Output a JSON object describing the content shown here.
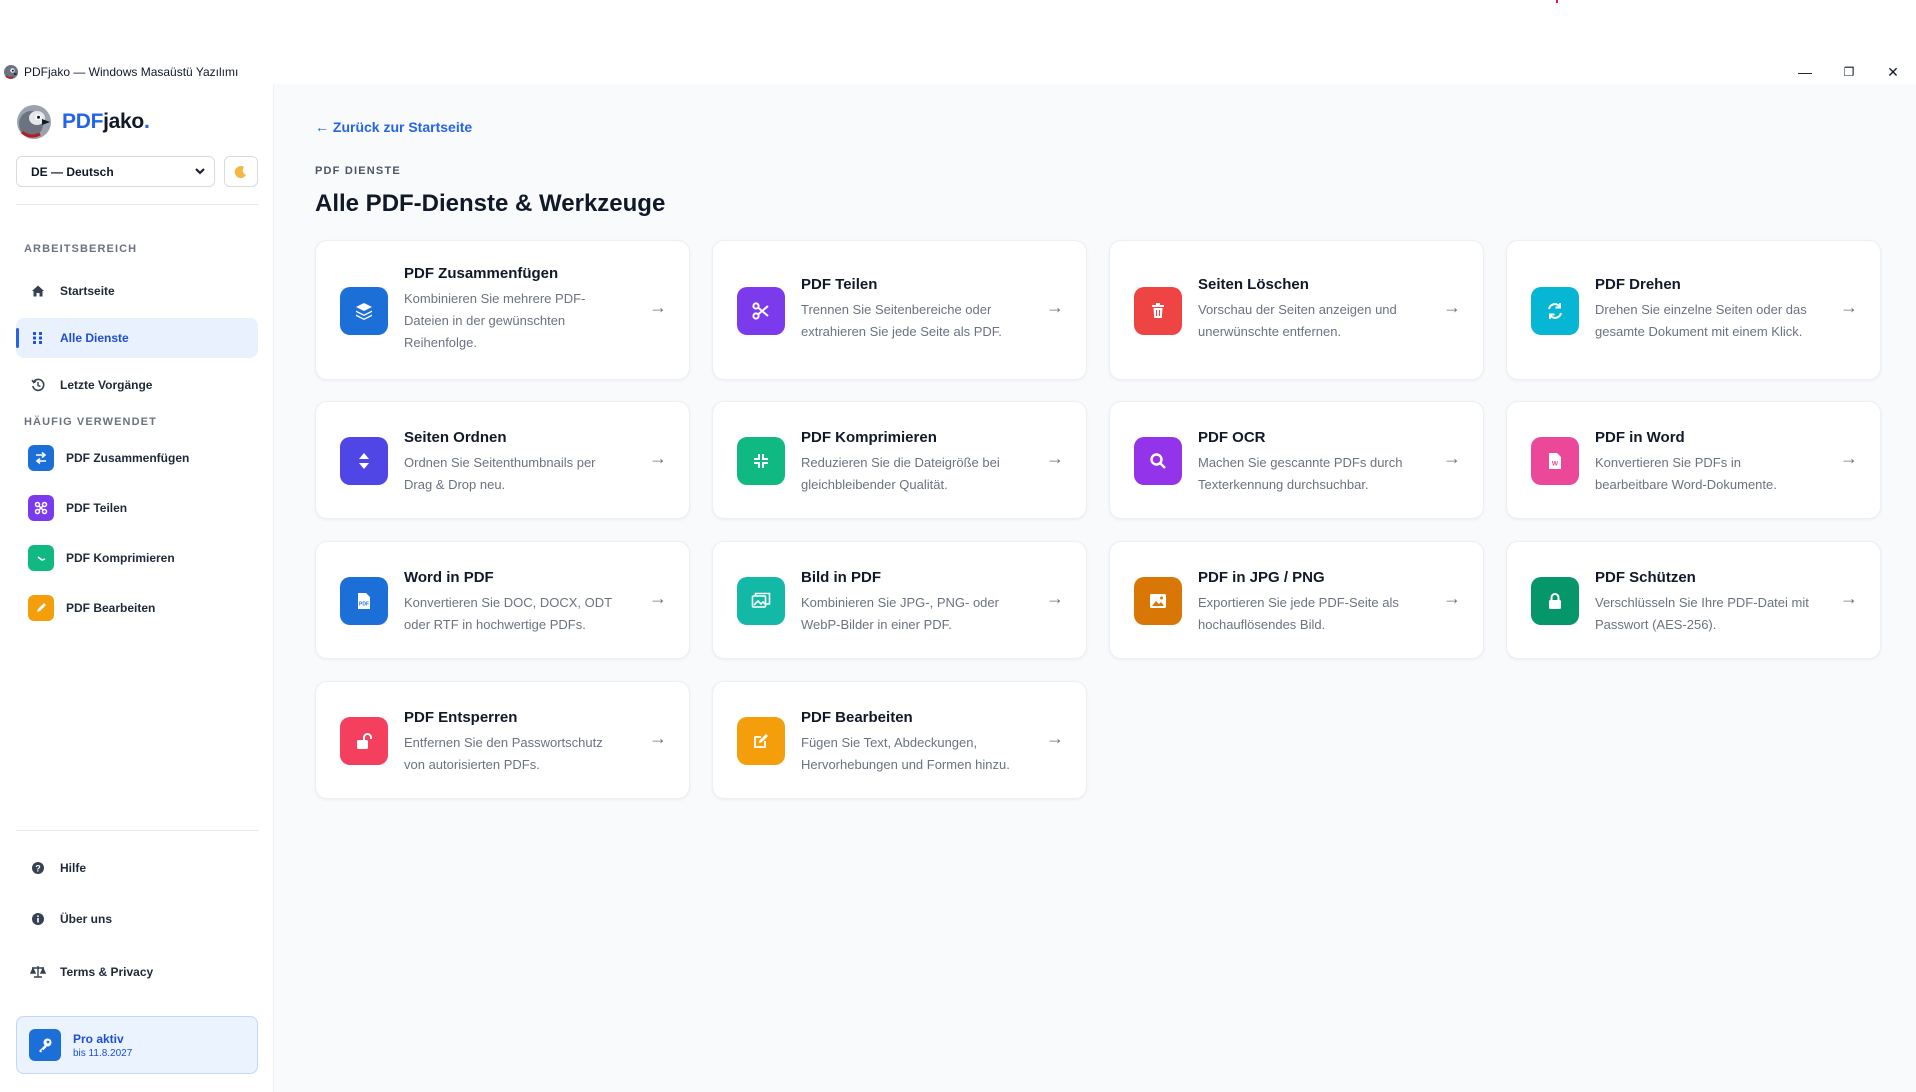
{
  "window": {
    "title": "PDFjako — Windows Masaüstü Yazılımı",
    "controls": {
      "minimize": "—",
      "maximize": "❐",
      "close": "✕"
    }
  },
  "sidebar": {
    "brand": {
      "part1": "PDF",
      "part2": "jako",
      "part3": "."
    },
    "language": {
      "selected": "DE — Deutsch"
    },
    "theme_toggle": {
      "icon": "moon-icon"
    },
    "workspace_label": "ARBEITSBEREICH",
    "nav": [
      {
        "label": "Startseite",
        "icon": "home-icon",
        "active": false
      },
      {
        "label": "Alle Dienste",
        "icon": "grid-icon",
        "active": true
      },
      {
        "label": "Letzte Vorgänge",
        "icon": "history-icon",
        "active": false
      }
    ],
    "favorites_label": "HÄUFIG VERWENDET",
    "favorites": [
      {
        "label": "PDF Zusammenfügen",
        "color": "#1d6fd8",
        "icon": "merge-icon"
      },
      {
        "label": "PDF Teilen",
        "color": "#7c3aed",
        "icon": "scissors-icon"
      },
      {
        "label": "PDF Komprimieren",
        "color": "#10b981",
        "icon": "compress-icon"
      },
      {
        "label": "PDF Bearbeiten",
        "color": "#f59e0b",
        "icon": "pencil-icon"
      }
    ],
    "footer": [
      {
        "label": "Hilfe",
        "icon": "help-icon"
      },
      {
        "label": "Über uns",
        "icon": "info-icon"
      },
      {
        "label": "Terms & Privacy",
        "icon": "scale-icon"
      }
    ],
    "pro": {
      "title": "Pro aktiv",
      "subtitle": "bis 11.8.2027",
      "icon": "key-icon"
    }
  },
  "main": {
    "back_link": "← Zurück zur Startseite",
    "eyebrow": "PDF DIENSTE",
    "title": "Alle PDF-Dienste & Werkzeuge",
    "arrow": "→",
    "services": [
      {
        "title": "PDF Zusammenfügen",
        "desc": "Kombinieren Sie mehrere PDF-Dateien in der gewünschten Reihenfolge.",
        "color": "#1d6fd8",
        "icon": "layers-icon"
      },
      {
        "title": "PDF Teilen",
        "desc": "Trennen Sie Seitenbereiche oder extrahieren Sie jede Seite als PDF.",
        "color": "#7c3aed",
        "icon": "scissors-icon"
      },
      {
        "title": "Seiten Löschen",
        "desc": "Vorschau der Seiten anzeigen und unerwünschte entfernen.",
        "color": "#ef4444",
        "icon": "trash-icon"
      },
      {
        "title": "PDF Drehen",
        "desc": "Drehen Sie einzelne Seiten oder das gesamte Dokument mit einem Klick.",
        "color": "#06b6d4",
        "icon": "rotate-icon"
      },
      {
        "title": "Seiten Ordnen",
        "desc": "Ordnen Sie Seitenthumbnails per Drag & Drop neu.",
        "color": "#4f46e5",
        "icon": "sort-icon"
      },
      {
        "title": "PDF Komprimieren",
        "desc": "Reduzieren Sie die Dateigröße bei gleichbleibender Qualität.",
        "color": "#10b981",
        "icon": "compress-icon"
      },
      {
        "title": "PDF OCR",
        "desc": "Machen Sie gescannte PDFs durch Texterkennung durchsuchbar.",
        "color": "#9333ea",
        "icon": "search-icon"
      },
      {
        "title": "PDF in Word",
        "desc": "Konvertieren Sie PDFs in bearbeitbare Word-Dokumente.",
        "color": "#ec4899",
        "icon": "word-file-icon"
      },
      {
        "title": "Word in PDF",
        "desc": "Konvertieren Sie DOC, DOCX, ODT oder RTF in hochwertige PDFs.",
        "color": "#1d6fd8",
        "icon": "pdf-file-icon"
      },
      {
        "title": "Bild in PDF",
        "desc": "Kombinieren Sie JPG-, PNG- oder WebP-Bilder in einer PDF.",
        "color": "#14b8a6",
        "icon": "images-icon"
      },
      {
        "title": "PDF in JPG / PNG",
        "desc": "Exportieren Sie jede PDF-Seite als hochauflösendes Bild.",
        "color": "#d97706",
        "icon": "image-icon"
      },
      {
        "title": "PDF Schützen",
        "desc": "Verschlüsseln Sie Ihre PDF-Datei mit Passwort (AES-256).",
        "color": "#059669",
        "icon": "lock-icon"
      },
      {
        "title": "PDF Entsperren",
        "desc": "Entfernen Sie den Passwortschutz von autorisierten PDFs.",
        "color": "#f43f5e",
        "icon": "unlock-icon"
      },
      {
        "title": "PDF Bearbeiten",
        "desc": "Fügen Sie Text, Abdeckungen, Hervorhebungen und Formen hinzu.",
        "color": "#f59e0b",
        "icon": "edit-icon"
      }
    ]
  }
}
